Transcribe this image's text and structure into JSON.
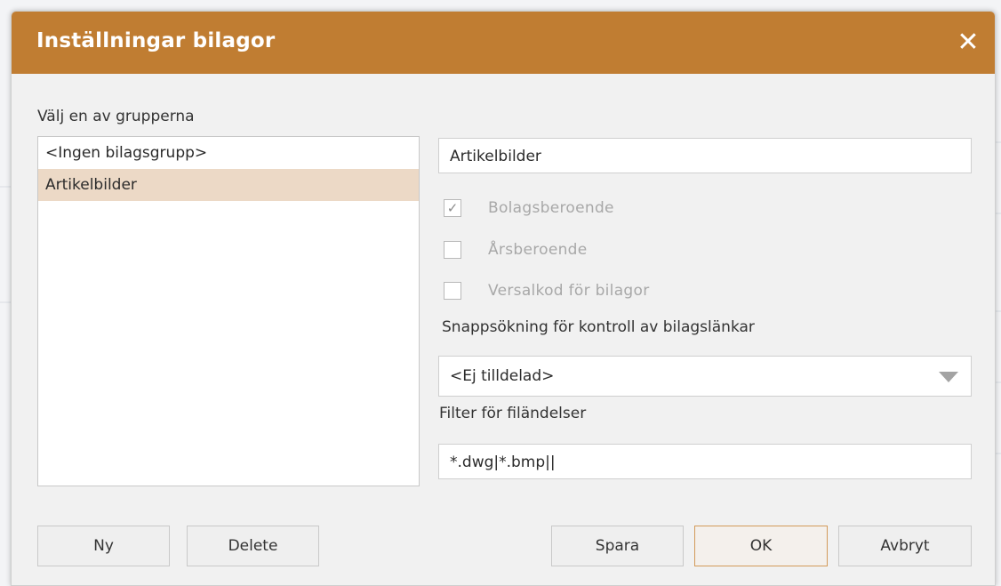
{
  "dialog": {
    "title": "Inställningar bilagor",
    "close_icon": "close-icon"
  },
  "groups": {
    "label": "Välj en av grupperna",
    "items": [
      {
        "label": "<Ingen bilagsgrupp>",
        "selected": false
      },
      {
        "label": "Artikelbilder",
        "selected": true
      }
    ]
  },
  "details": {
    "name_value": "Artikelbilder",
    "checkboxes": [
      {
        "label": "Bolagsberoende",
        "checked": true
      },
      {
        "label": "Årsberoende",
        "checked": false
      },
      {
        "label": "Versalkod för bilagor",
        "checked": false
      }
    ],
    "search_label": "Snappsökning för kontroll av bilagslänkar",
    "search_selected": "<Ej tilldelad>",
    "filter_label": "Filter för filändelser",
    "filter_value": "*.dwg|*.bmp||"
  },
  "buttons": {
    "new": "Ny",
    "delete": "Delete",
    "save": "Spara",
    "ok": "OK",
    "cancel": "Avbryt"
  },
  "colors": {
    "titlebar": "#c07d32",
    "selection": "#ecd9c6",
    "default_button_border": "#d39a5a"
  }
}
